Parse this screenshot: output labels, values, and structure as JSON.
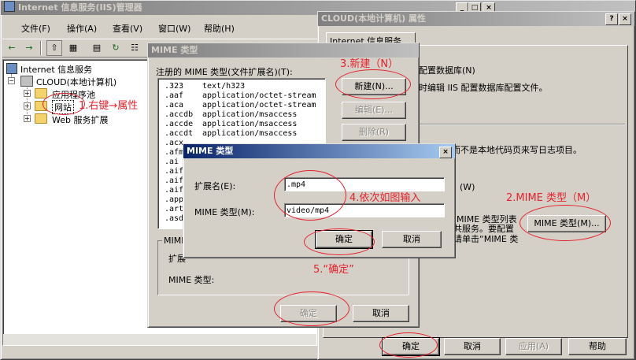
{
  "main_window": {
    "title": "Internet 信息服务(IIS)管理器",
    "menu": [
      "文件(F)",
      "操作(A)",
      "查看(V)",
      "窗口(W)",
      "帮助(H)"
    ],
    "tree": {
      "root": "Internet 信息服务",
      "server": "CLOUD(本地计算机)",
      "children": [
        "应用程序池",
        "网站",
        "Web 服务扩展"
      ]
    }
  },
  "props_window": {
    "title": "CLOUD(本地计算机) 属性",
    "tab_partial": "Internet 信息服务",
    "text_db": "配置数据库(N)",
    "text_db2": "时编辑 IIS 配置数据库配置文件。",
    "text_log": "而不是本地代码页来写日志项目。",
    "text_w": "(W)",
    "text_mime1": "MIME 类型列表",
    "text_mime2": "共服务。要配置",
    "text_mime3": "请单击“MIME 类",
    "mime_button": "MIME 类型(M)...",
    "buttons": [
      "确定",
      "取消",
      "应用(A)",
      "帮助"
    ]
  },
  "mime_list_dialog": {
    "title": "MIME 类型",
    "list_label": "注册的 MIME 类型(文件扩展名)(T):",
    "rows": [
      [
        ".323",
        "text/h323"
      ],
      [
        ".aaf",
        "application/octet-stream"
      ],
      [
        ".aca",
        "application/octet-stream"
      ],
      [
        ".accdb",
        "application/msaccess"
      ],
      [
        ".accde",
        "application/msaccess"
      ],
      [
        ".accdt",
        "application/msaccess"
      ],
      [
        ".acx",
        ""
      ],
      [
        ".afm",
        ""
      ],
      [
        ".ai",
        ""
      ],
      [
        ".aif",
        ""
      ],
      [
        ".aifc",
        ""
      ],
      [
        ".aiff",
        ""
      ],
      [
        ".appl",
        ""
      ],
      [
        ".art",
        ""
      ],
      [
        ".asd",
        ""
      ]
    ],
    "new_button": "新建(N)...",
    "edit_button": "编辑(E)...",
    "delete_button": "删除(R)",
    "group_label": "MIME",
    "ext_label_partial": "扩展",
    "mime_type_label": "MIME 类型:",
    "ok": "确定",
    "cancel": "取消"
  },
  "mime_entry_dialog": {
    "title": "MIME 类型",
    "ext_label": "扩展名(E):",
    "ext_value": ".mp4",
    "mime_label": "MIME 类型(M):",
    "mime_value": "video/mp4",
    "ok": "确定",
    "cancel": "取消"
  },
  "annotations": {
    "step1": "1.右键→属性",
    "step2": "2.MIME 类型（M）",
    "step3": "3.新建（N）",
    "step4": "4.依次如图输入",
    "step5": "5.“确定”",
    "color": "#e8212b"
  },
  "colors": {
    "title_active": "#0a246a",
    "title_inactive": "#808080",
    "face": "#d4d0c8"
  }
}
